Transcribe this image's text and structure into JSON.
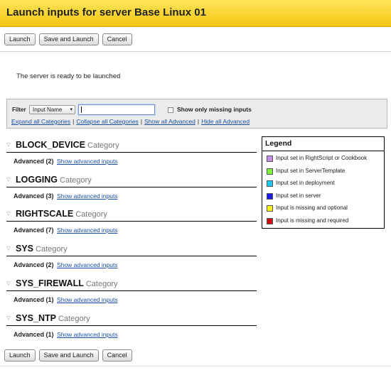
{
  "title": "Launch inputs for server Base Linux 01",
  "buttons": {
    "launch": "Launch",
    "save_and_launch": "Save and Launch",
    "cancel": "Cancel"
  },
  "status_message": "The server is ready to be launched",
  "filter": {
    "label": "Filter",
    "select_value": "Input Name",
    "input_value": "",
    "checkbox_label": "Show only missing inputs",
    "checkbox_checked": false,
    "links": {
      "expand": "Expand all Categories",
      "collapse": "Collapse all Categories",
      "show_adv": "Show all Advanced",
      "hide_adv": "Hide all Advanced"
    }
  },
  "category_suffix": "Category",
  "advanced_label": "Advanced",
  "show_advanced_link": "Show advanced inputs",
  "categories": [
    {
      "name": "BLOCK_DEVICE",
      "count": "(2)"
    },
    {
      "name": "LOGGING",
      "count": "(3)"
    },
    {
      "name": "RIGHTSCALE",
      "count": "(7)"
    },
    {
      "name": "SYS",
      "count": "(2)"
    },
    {
      "name": "SYS_FIREWALL",
      "count": "(1)"
    },
    {
      "name": "SYS_NTP",
      "count": "(1)"
    }
  ],
  "legend": {
    "title": "Legend",
    "items": [
      {
        "label": "Input set in RightScript or Cookbook",
        "color": "#c58ee6"
      },
      {
        "label": "Input set in ServerTemplate",
        "color": "#7ef23c"
      },
      {
        "label": "Input set in deployment",
        "color": "#1ec8f0"
      },
      {
        "label": "Input set in server",
        "color": "#1a1ae8"
      },
      {
        "label": "Input is missing and optional",
        "color": "#f5f21a"
      },
      {
        "label": "Input is missing and required",
        "color": "#c81010"
      }
    ]
  },
  "icons": {
    "expand_toggle": "triangle-down-icon",
    "select_caret": "chevron-down-icon"
  }
}
